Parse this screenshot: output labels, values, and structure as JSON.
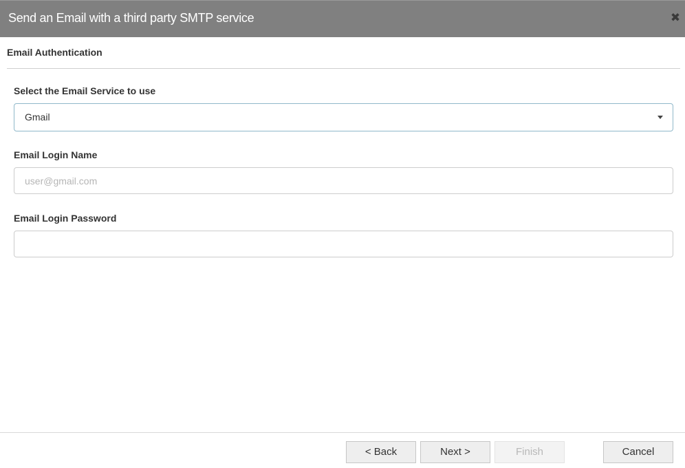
{
  "dialog": {
    "title": "Send an Email with a third party SMTP service",
    "close_glyph": "✖"
  },
  "section": {
    "heading": "Email Authentication"
  },
  "fields": {
    "service": {
      "label": "Select the Email Service to use",
      "value": "Gmail"
    },
    "login_name": {
      "label": "Email Login Name",
      "value": "",
      "placeholder": "user@gmail.com"
    },
    "login_password": {
      "label": "Email Login Password",
      "value": "",
      "placeholder": ""
    }
  },
  "footer": {
    "back_label": "< Back",
    "next_label": "Next >",
    "finish_label": "Finish",
    "cancel_label": "Cancel"
  },
  "colors": {
    "titlebar": "#808080",
    "title_text": "#ffffff",
    "select_border": "#8fb8c9"
  }
}
